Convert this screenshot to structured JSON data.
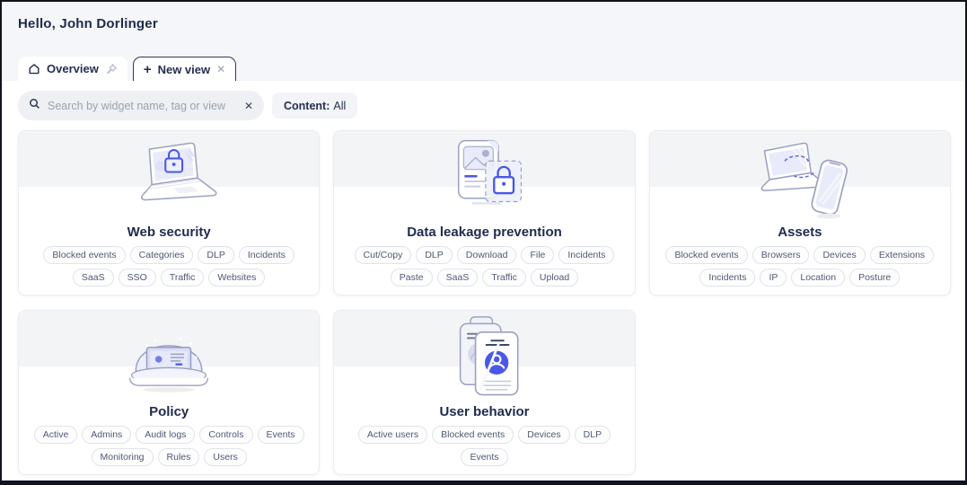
{
  "header": {
    "greeting": "Hello, John Dorlinger"
  },
  "tabs": [
    {
      "label": "Overview"
    },
    {
      "label": "New view",
      "close_glyph": "✕"
    }
  ],
  "toolbar": {
    "search_placeholder": "Search by widget name, tag or view",
    "search_clear_glyph": "✕",
    "content_filter_label": "Content:",
    "content_filter_value": "All"
  },
  "cards": [
    {
      "title": "Web security",
      "illustration": "laptop-lock",
      "tags": [
        "Blocked events",
        "Categories",
        "DLP",
        "Incidents",
        "SaaS",
        "SSO",
        "Traffic",
        "Websites"
      ]
    },
    {
      "title": "Data leakage prevention",
      "illustration": "doc-lock",
      "tags": [
        "Cut/Copy",
        "DLP",
        "Download",
        "File",
        "Incidents",
        "Paste",
        "SaaS",
        "Traffic",
        "Upload"
      ]
    },
    {
      "title": "Assets",
      "illustration": "devices",
      "tags": [
        "Blocked events",
        "Browsers",
        "Devices",
        "Extensions",
        "Incidents",
        "IP",
        "Location",
        "Posture"
      ]
    },
    {
      "title": "Policy",
      "illustration": "snow-globe",
      "tags": [
        "Active",
        "Admins",
        "Audit logs",
        "Controls",
        "Events",
        "Monitoring",
        "Rules",
        "Users"
      ]
    },
    {
      "title": "User behavior",
      "illustration": "id-cards",
      "tags": [
        "Active users",
        "Blocked events",
        "Devices",
        "DLP",
        "Events"
      ]
    }
  ],
  "colors": {
    "accent_blue": "#4a57e8",
    "navy_text": "#1e2a4a",
    "header_band": "#f5f6f9",
    "card_banner": "#f3f4f6",
    "search_fill": "#eef0f4"
  }
}
